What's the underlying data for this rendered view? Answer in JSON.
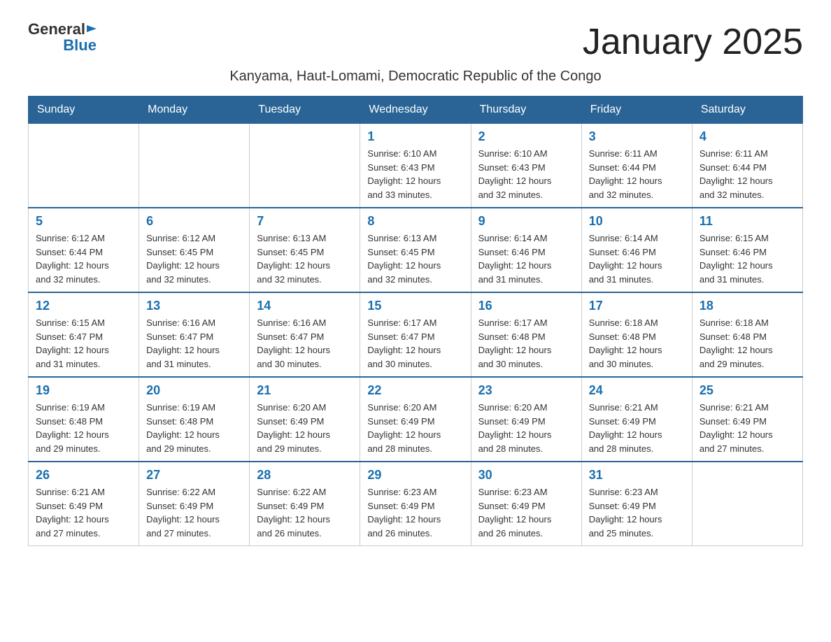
{
  "header": {
    "logo_general": "General",
    "logo_blue": "Blue",
    "page_title": "January 2025"
  },
  "subtitle": "Kanyama, Haut-Lomami, Democratic Republic of the Congo",
  "days_of_week": [
    "Sunday",
    "Monday",
    "Tuesday",
    "Wednesday",
    "Thursday",
    "Friday",
    "Saturday"
  ],
  "weeks": [
    [
      {
        "day": "",
        "info": ""
      },
      {
        "day": "",
        "info": ""
      },
      {
        "day": "",
        "info": ""
      },
      {
        "day": "1",
        "info": "Sunrise: 6:10 AM\nSunset: 6:43 PM\nDaylight: 12 hours\nand 33 minutes."
      },
      {
        "day": "2",
        "info": "Sunrise: 6:10 AM\nSunset: 6:43 PM\nDaylight: 12 hours\nand 32 minutes."
      },
      {
        "day": "3",
        "info": "Sunrise: 6:11 AM\nSunset: 6:44 PM\nDaylight: 12 hours\nand 32 minutes."
      },
      {
        "day": "4",
        "info": "Sunrise: 6:11 AM\nSunset: 6:44 PM\nDaylight: 12 hours\nand 32 minutes."
      }
    ],
    [
      {
        "day": "5",
        "info": "Sunrise: 6:12 AM\nSunset: 6:44 PM\nDaylight: 12 hours\nand 32 minutes."
      },
      {
        "day": "6",
        "info": "Sunrise: 6:12 AM\nSunset: 6:45 PM\nDaylight: 12 hours\nand 32 minutes."
      },
      {
        "day": "7",
        "info": "Sunrise: 6:13 AM\nSunset: 6:45 PM\nDaylight: 12 hours\nand 32 minutes."
      },
      {
        "day": "8",
        "info": "Sunrise: 6:13 AM\nSunset: 6:45 PM\nDaylight: 12 hours\nand 32 minutes."
      },
      {
        "day": "9",
        "info": "Sunrise: 6:14 AM\nSunset: 6:46 PM\nDaylight: 12 hours\nand 31 minutes."
      },
      {
        "day": "10",
        "info": "Sunrise: 6:14 AM\nSunset: 6:46 PM\nDaylight: 12 hours\nand 31 minutes."
      },
      {
        "day": "11",
        "info": "Sunrise: 6:15 AM\nSunset: 6:46 PM\nDaylight: 12 hours\nand 31 minutes."
      }
    ],
    [
      {
        "day": "12",
        "info": "Sunrise: 6:15 AM\nSunset: 6:47 PM\nDaylight: 12 hours\nand 31 minutes."
      },
      {
        "day": "13",
        "info": "Sunrise: 6:16 AM\nSunset: 6:47 PM\nDaylight: 12 hours\nand 31 minutes."
      },
      {
        "day": "14",
        "info": "Sunrise: 6:16 AM\nSunset: 6:47 PM\nDaylight: 12 hours\nand 30 minutes."
      },
      {
        "day": "15",
        "info": "Sunrise: 6:17 AM\nSunset: 6:47 PM\nDaylight: 12 hours\nand 30 minutes."
      },
      {
        "day": "16",
        "info": "Sunrise: 6:17 AM\nSunset: 6:48 PM\nDaylight: 12 hours\nand 30 minutes."
      },
      {
        "day": "17",
        "info": "Sunrise: 6:18 AM\nSunset: 6:48 PM\nDaylight: 12 hours\nand 30 minutes."
      },
      {
        "day": "18",
        "info": "Sunrise: 6:18 AM\nSunset: 6:48 PM\nDaylight: 12 hours\nand 29 minutes."
      }
    ],
    [
      {
        "day": "19",
        "info": "Sunrise: 6:19 AM\nSunset: 6:48 PM\nDaylight: 12 hours\nand 29 minutes."
      },
      {
        "day": "20",
        "info": "Sunrise: 6:19 AM\nSunset: 6:48 PM\nDaylight: 12 hours\nand 29 minutes."
      },
      {
        "day": "21",
        "info": "Sunrise: 6:20 AM\nSunset: 6:49 PM\nDaylight: 12 hours\nand 29 minutes."
      },
      {
        "day": "22",
        "info": "Sunrise: 6:20 AM\nSunset: 6:49 PM\nDaylight: 12 hours\nand 28 minutes."
      },
      {
        "day": "23",
        "info": "Sunrise: 6:20 AM\nSunset: 6:49 PM\nDaylight: 12 hours\nand 28 minutes."
      },
      {
        "day": "24",
        "info": "Sunrise: 6:21 AM\nSunset: 6:49 PM\nDaylight: 12 hours\nand 28 minutes."
      },
      {
        "day": "25",
        "info": "Sunrise: 6:21 AM\nSunset: 6:49 PM\nDaylight: 12 hours\nand 27 minutes."
      }
    ],
    [
      {
        "day": "26",
        "info": "Sunrise: 6:21 AM\nSunset: 6:49 PM\nDaylight: 12 hours\nand 27 minutes."
      },
      {
        "day": "27",
        "info": "Sunrise: 6:22 AM\nSunset: 6:49 PM\nDaylight: 12 hours\nand 27 minutes."
      },
      {
        "day": "28",
        "info": "Sunrise: 6:22 AM\nSunset: 6:49 PM\nDaylight: 12 hours\nand 26 minutes."
      },
      {
        "day": "29",
        "info": "Sunrise: 6:23 AM\nSunset: 6:49 PM\nDaylight: 12 hours\nand 26 minutes."
      },
      {
        "day": "30",
        "info": "Sunrise: 6:23 AM\nSunset: 6:49 PM\nDaylight: 12 hours\nand 26 minutes."
      },
      {
        "day": "31",
        "info": "Sunrise: 6:23 AM\nSunset: 6:49 PM\nDaylight: 12 hours\nand 25 minutes."
      },
      {
        "day": "",
        "info": ""
      }
    ]
  ]
}
